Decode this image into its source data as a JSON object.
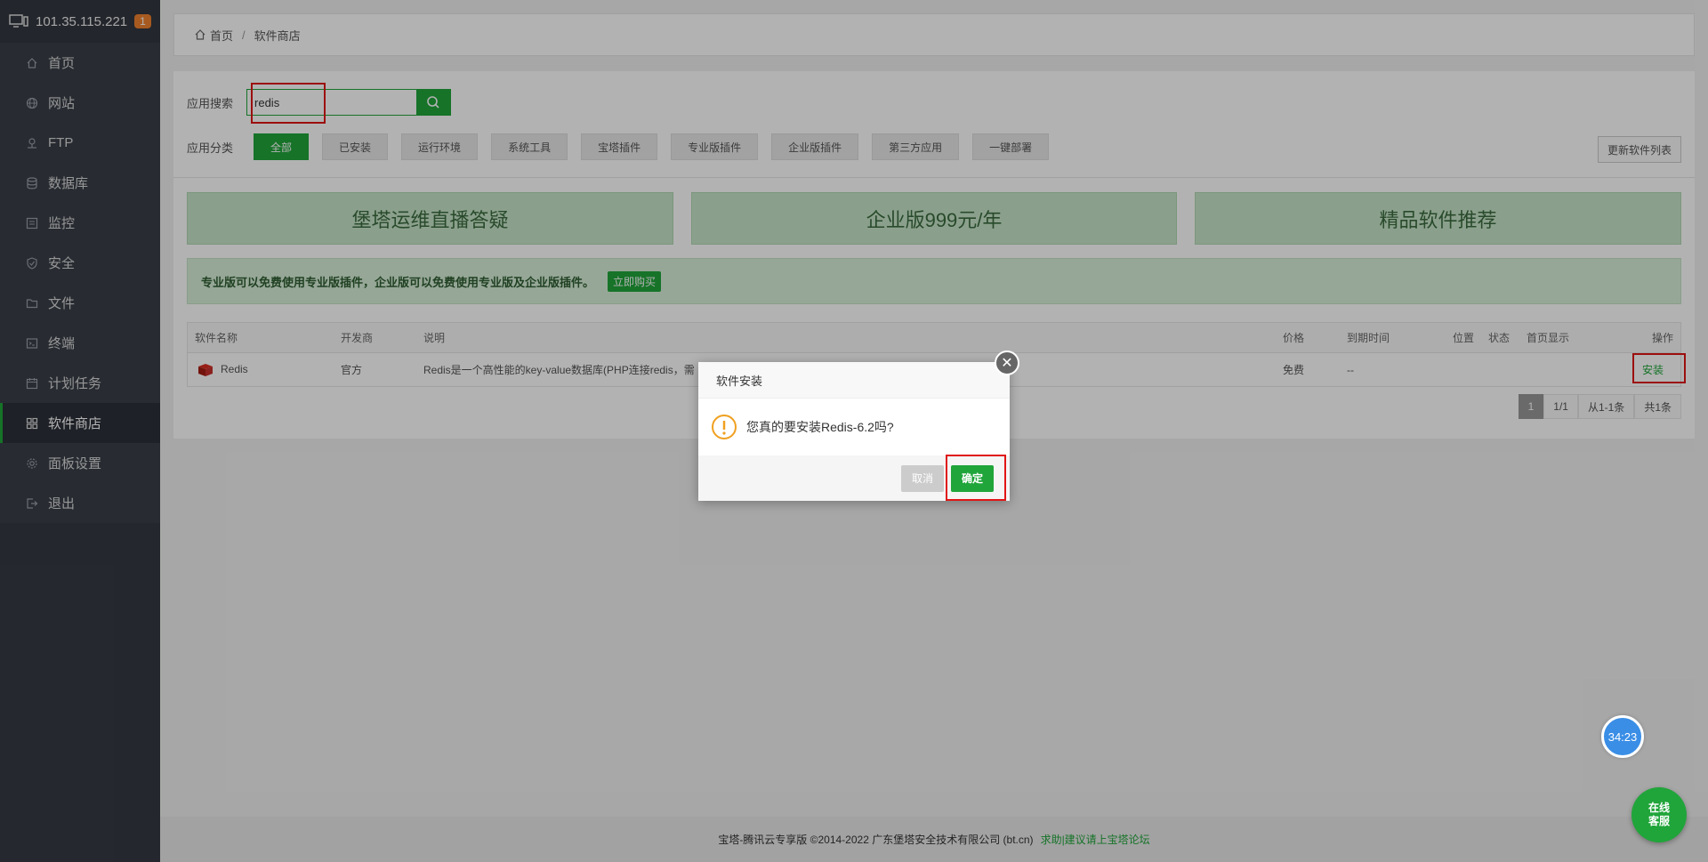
{
  "sidebar": {
    "server_ip": "101.35.115.221",
    "notification_count": "1",
    "items": [
      {
        "label": "首页",
        "icon": "home-icon"
      },
      {
        "label": "网站",
        "icon": "globe-icon"
      },
      {
        "label": "FTP",
        "icon": "ftp-icon"
      },
      {
        "label": "数据库",
        "icon": "database-icon"
      },
      {
        "label": "监控",
        "icon": "monitor-icon"
      },
      {
        "label": "安全",
        "icon": "shield-icon"
      },
      {
        "label": "文件",
        "icon": "folder-icon"
      },
      {
        "label": "终端",
        "icon": "terminal-icon"
      },
      {
        "label": "计划任务",
        "icon": "calendar-icon"
      },
      {
        "label": "软件商店",
        "icon": "apps-icon"
      },
      {
        "label": "面板设置",
        "icon": "gear-icon"
      },
      {
        "label": "退出",
        "icon": "logout-icon"
      }
    ]
  },
  "breadcrumb": {
    "home": "首页",
    "current": "软件商店"
  },
  "search": {
    "label": "应用搜索",
    "value": "redis"
  },
  "categories": {
    "label": "应用分类",
    "items": [
      "全部",
      "已安装",
      "运行环境",
      "系统工具",
      "宝塔插件",
      "专业版插件",
      "企业版插件",
      "第三方应用",
      "一键部署"
    ],
    "refresh_label": "更新软件列表"
  },
  "promos": [
    "堡塔运维直播答疑",
    "企业版999元/年",
    "精品软件推荐"
  ],
  "notice": {
    "text": "专业版可以免费使用专业版插件，企业版可以免费使用专业版及企业版插件。",
    "button": "立即购买"
  },
  "table": {
    "headers": {
      "name": "软件名称",
      "developer": "开发商",
      "desc": "说明",
      "price": "价格",
      "expire": "到期时间",
      "position": "位置",
      "status": "状态",
      "home": "首页显示",
      "action": "操作"
    },
    "row": {
      "name": "Redis",
      "developer": "官方",
      "desc": "Redis是一个高性能的key-value数据库(PHP连接redis，需",
      "price": "免费",
      "expire": "--",
      "action": "安装"
    }
  },
  "pager": {
    "current": "1",
    "pages": "1/1",
    "range": "从1-1条",
    "total": "共1条"
  },
  "footer": {
    "copyright": "宝塔-腾讯云专享版 ©2014-2022 广东堡塔安全技术有限公司 (bt.cn)",
    "link": "求助|建议请上宝塔论坛"
  },
  "dialog": {
    "title": "软件安装",
    "message": "您真的要安装Redis-6.2吗?",
    "cancel": "取消",
    "ok": "确定"
  },
  "timer": "34:23",
  "chat": {
    "line1": "在线",
    "line2": "客服"
  },
  "colors": {
    "accent": "#20a53a",
    "sidebar": "#3a3f48",
    "highlight": "#e01515"
  }
}
